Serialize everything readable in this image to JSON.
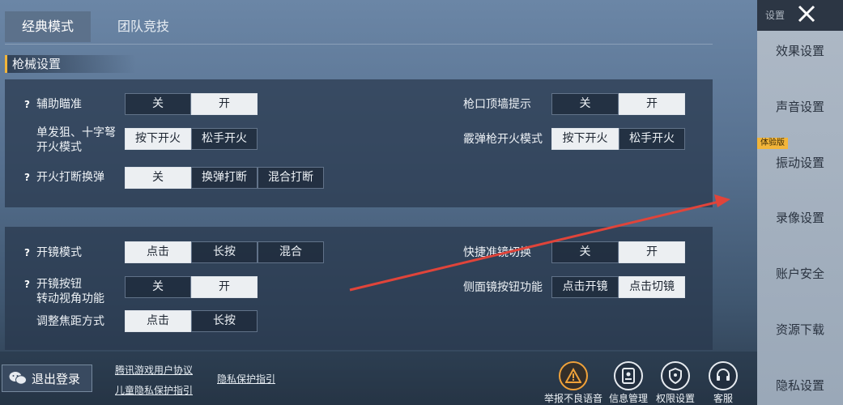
{
  "tabs": [
    {
      "label": "经典模式",
      "active": true
    },
    {
      "label": "团队竞技",
      "active": false
    }
  ],
  "section_title": "枪械设置",
  "panel1": {
    "aim_assist": {
      "label": "辅助瞄准",
      "options": [
        "关",
        "开"
      ],
      "selected": 1
    },
    "muzzle_hint": {
      "label": "枪口顶墙提示",
      "options": [
        "关",
        "开"
      ],
      "selected": 1
    },
    "sniper_fire": {
      "label_line1": "单发狙、十字弩",
      "label_line2": "开火模式",
      "options": [
        "按下开火",
        "松手开火"
      ],
      "selected": 0
    },
    "shotgun_fire": {
      "label": "霰弹枪开火模式",
      "options": [
        "按下开火",
        "松手开火"
      ],
      "selected": 0
    },
    "fire_interrupt": {
      "label": "开火打断换弹",
      "options": [
        "关",
        "换弹打断",
        "混合打断"
      ],
      "selected": 0
    }
  },
  "panel2": {
    "scope_mode": {
      "label": "开镜模式",
      "options": [
        "点击",
        "长按",
        "混合"
      ],
      "selected": 0
    },
    "quick_scope": {
      "label": "快捷准镜切换",
      "options": [
        "关",
        "开"
      ],
      "selected": 1
    },
    "scope_btn": {
      "label_line1": "开镜按钮",
      "label_line2": "转动视角功能",
      "options": [
        "关",
        "开"
      ],
      "selected": 1
    },
    "side_scope": {
      "label": "侧面镜按钮功能",
      "options": [
        "点击开镜",
        "点击切镜"
      ],
      "selected": 1
    },
    "focus_mode": {
      "label": "调整焦距方式",
      "options": [
        "点击",
        "长按"
      ],
      "selected": 0
    }
  },
  "sidebar": {
    "header": "设置",
    "badge": "体验版",
    "items": [
      "效果设置",
      "声音设置",
      "振动设置",
      "录像设置",
      "账户安全",
      "资源下载",
      "隐私设置"
    ]
  },
  "bottom": {
    "logout": "退出登录",
    "links": [
      "腾讯游戏用户协议",
      "儿童隐私保护指引",
      "隐私保护指引"
    ],
    "actions": [
      "举报不良语音",
      "信息管理",
      "权限设置",
      "客服"
    ]
  },
  "colors": {
    "accent": "#f2b53a",
    "selected_bg": "#eceff2",
    "annotation_arrow": "#e0443a"
  },
  "icons": [
    "help-icon",
    "close-icon",
    "wechat-icon",
    "warning-icon",
    "info-manage-icon",
    "shield-icon",
    "headset-icon"
  ]
}
